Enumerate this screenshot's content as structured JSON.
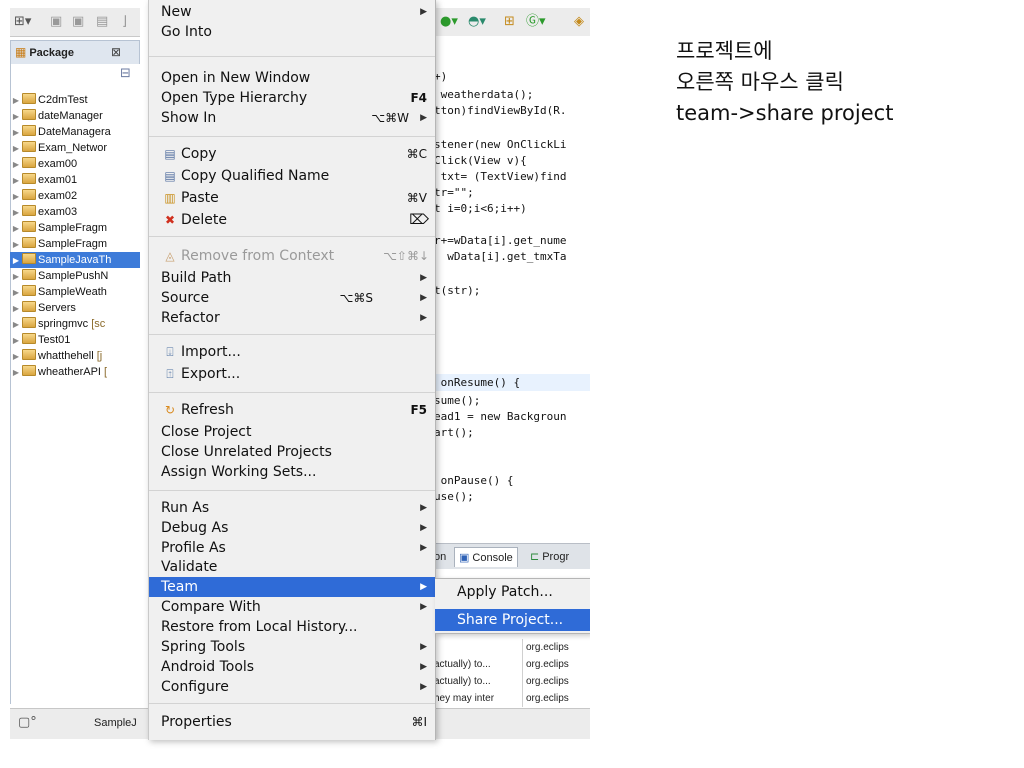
{
  "package_explorer": {
    "tab_label": "Package",
    "projects": [
      {
        "name": "C2dmTest"
      },
      {
        "name": "dateManager"
      },
      {
        "name": "DateManagera"
      },
      {
        "name": "Exam_Networ"
      },
      {
        "name": "exam00"
      },
      {
        "name": "exam01"
      },
      {
        "name": "exam02"
      },
      {
        "name": "exam03"
      },
      {
        "name": "SampleFragm"
      },
      {
        "name": "SampleFragm"
      },
      {
        "name": "SampleJavaTh",
        "selected": true
      },
      {
        "name": "SamplePushN"
      },
      {
        "name": "SampleWeath"
      },
      {
        "name": "Servers"
      },
      {
        "name": "springmvc",
        "extra": "[sc"
      },
      {
        "name": "Test01"
      },
      {
        "name": "whatthehell",
        "extra": "[j"
      },
      {
        "name": "wheatherAPI",
        "extra": "["
      }
    ]
  },
  "bottom_bar": {
    "label": "SampleJ"
  },
  "context_menu": {
    "items": {
      "new": {
        "label": "New"
      },
      "go_into": {
        "label": "Go Into"
      },
      "open_new_window": {
        "label": "Open in New Window"
      },
      "open_type_hierarchy": {
        "label": "Open Type Hierarchy",
        "shortcut": "F4"
      },
      "show_in": {
        "label": "Show In",
        "shortcut": "⌥⌘W"
      },
      "copy": {
        "label": "Copy",
        "shortcut": "⌘C"
      },
      "copy_qualified_name": {
        "label": "Copy Qualified Name"
      },
      "paste": {
        "label": "Paste",
        "shortcut": "⌘V"
      },
      "delete": {
        "label": "Delete",
        "shortcut": "⌦"
      },
      "remove_from_context": {
        "label": "Remove from Context",
        "shortcut": "⌥⇧⌘↓"
      },
      "build_path": {
        "label": "Build Path"
      },
      "source": {
        "label": "Source",
        "shortcut": "⌥⌘S"
      },
      "refactor": {
        "label": "Refactor"
      },
      "import": {
        "label": "Import..."
      },
      "export": {
        "label": "Export..."
      },
      "refresh": {
        "label": "Refresh",
        "shortcut": "F5"
      },
      "close_project": {
        "label": "Close Project"
      },
      "close_unrelated": {
        "label": "Close Unrelated Projects"
      },
      "assign_working_sets": {
        "label": "Assign Working Sets..."
      },
      "run_as": {
        "label": "Run As"
      },
      "debug_as": {
        "label": "Debug As"
      },
      "profile_as": {
        "label": "Profile As"
      },
      "validate": {
        "label": "Validate"
      },
      "team": {
        "label": "Team"
      },
      "compare_with": {
        "label": "Compare With"
      },
      "restore_history": {
        "label": "Restore from Local History..."
      },
      "spring_tools": {
        "label": "Spring Tools"
      },
      "android_tools": {
        "label": "Android Tools"
      },
      "configure": {
        "label": "Configure"
      },
      "properties": {
        "label": "Properties",
        "shortcut": "⌘I"
      }
    }
  },
  "team_submenu": {
    "apply_patch": "Apply Patch...",
    "share_project": "Share Project..."
  },
  "editor": {
    "lines": {
      "l1": "+)",
      "l2": " weatherdata();",
      "l3": "tton)findViewById(R.",
      "l4": "stener(new OnClickLi",
      "l5": "Click(View v){",
      "l6": " txt= (TextView)find",
      "l7": "tr=\"\";",
      "l8": "t i=0;i<6;i++)",
      "l9": "r+=wData[i].get_nume",
      "l10": "  wData[i].get_tmxTa",
      "l11": "t(str);",
      "l12": " onResume() {",
      "l13": "sume();",
      "l14": "ead1 = new Backgroun",
      "l15": "art();",
      "l16": " onPause() {",
      "l17": "use();"
    }
  },
  "console_tabs": {
    "partial": "on",
    "console": "Console",
    "progress": "Progr"
  },
  "problems": {
    "rows": [
      {
        "desc": "",
        "location": "org.eclips"
      },
      {
        "desc": "actually) to...",
        "location": "org.eclips"
      },
      {
        "desc": "actually) to...",
        "location": "org.eclips"
      },
      {
        "desc": "hey may inter",
        "location": "org.eclips"
      }
    ]
  },
  "annotation": {
    "line1": "프로젝트에",
    "line2": "오른쪽 마우스 클릭",
    "line3": "team->share project"
  }
}
